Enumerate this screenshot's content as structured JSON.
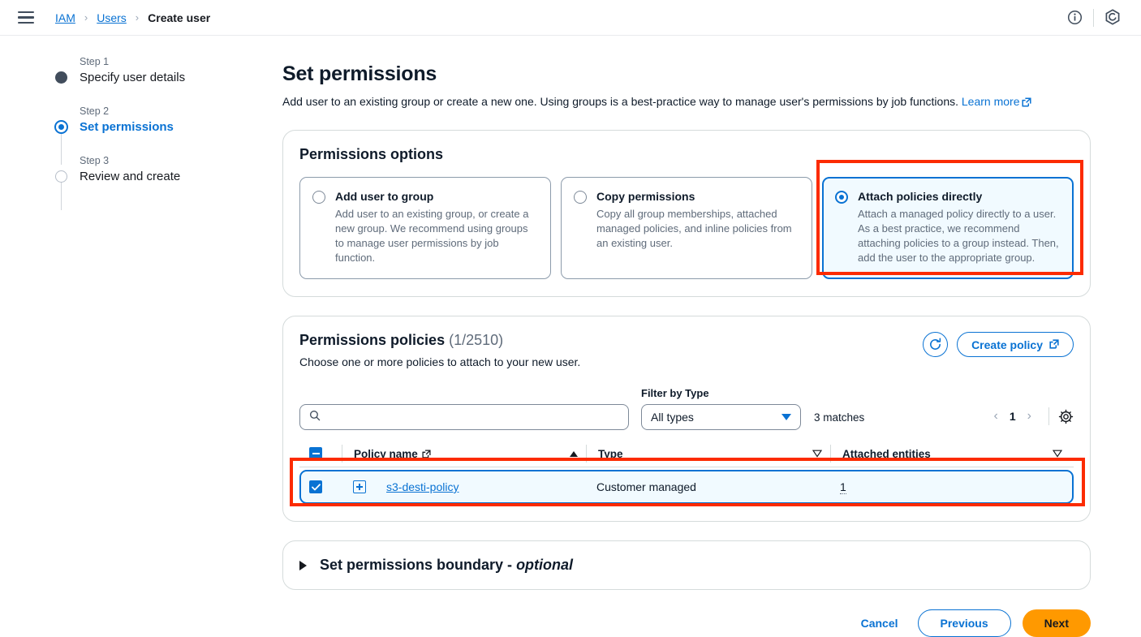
{
  "topbar": {
    "menu_icon": "hamburger-menu-icon",
    "breadcrumb": [
      {
        "label": "IAM",
        "link": true
      },
      {
        "label": "Users",
        "link": true
      },
      {
        "label": "Create user",
        "link": false
      }
    ],
    "separator": "›",
    "info_icon": "info-circle-icon",
    "settings_icon": "hexagon-settings-icon"
  },
  "stepper": {
    "steps": [
      {
        "number": "Step 1",
        "title": "Specify user details",
        "state": "done"
      },
      {
        "number": "Step 2",
        "title": "Set permissions",
        "state": "current"
      },
      {
        "number": "Step 3",
        "title": "Review and create",
        "state": "todo"
      }
    ]
  },
  "page": {
    "title": "Set permissions",
    "description": "Add user to an existing group or create a new one. Using groups is a best-practice way to manage user's permissions by job functions.",
    "learn_more": "Learn more",
    "external_link_icon": "external-link-icon"
  },
  "permissions_options": {
    "heading": "Permissions options",
    "cards": [
      {
        "title": "Add user to group",
        "description": "Add user to an existing group, or create a new group. We recommend using groups to manage user permissions by job function.",
        "selected": false
      },
      {
        "title": "Copy permissions",
        "description": "Copy all group memberships, attached managed policies, and inline policies from an existing user.",
        "selected": false
      },
      {
        "title": "Attach policies directly",
        "description": "Attach a managed policy directly to a user. As a best practice, we recommend attaching policies to a group instead. Then, add the user to the appropriate group.",
        "selected": true
      }
    ]
  },
  "permissions_policies": {
    "title": "Permissions policies",
    "count": "(1/2510)",
    "subtitle": "Choose one or more policies to attach to your new user.",
    "refresh_icon": "refresh-icon",
    "create_policy_label": "Create policy",
    "search": {
      "value": "",
      "placeholder": "",
      "icon": "search-icon"
    },
    "filter": {
      "label": "Filter by Type",
      "selected": "All types",
      "caret_icon": "caret-down-icon"
    },
    "matches": "3 matches",
    "pagination": {
      "prev_icon": "chevron-left-icon",
      "page": "1",
      "next_icon": "chevron-right-icon",
      "settings_icon": "gear-icon"
    },
    "table": {
      "select_all_state": "indeterminate",
      "columns": [
        {
          "label": "Policy name",
          "has_external_link": true,
          "sort": "asc"
        },
        {
          "label": "Type",
          "has_external_link": false,
          "sort": "none"
        },
        {
          "label": "Attached entities",
          "has_external_link": false,
          "sort": "none"
        }
      ],
      "rows": [
        {
          "checked": true,
          "expand_icon": "expand-plus-icon",
          "policy_name": "s3-desti-policy",
          "type": "Customer managed",
          "attached_entities": "1"
        }
      ]
    }
  },
  "permissions_boundary": {
    "expand_icon": "triangle-right-icon",
    "title": "Set permissions boundary - ",
    "optional": "optional"
  },
  "footer": {
    "cancel": "Cancel",
    "previous": "Previous",
    "next": "Next"
  },
  "colors": {
    "link_blue": "#0972d3",
    "selected_bg": "#f1faff",
    "annotation_red": "#fc2b00",
    "next_orange": "#ff9900"
  }
}
